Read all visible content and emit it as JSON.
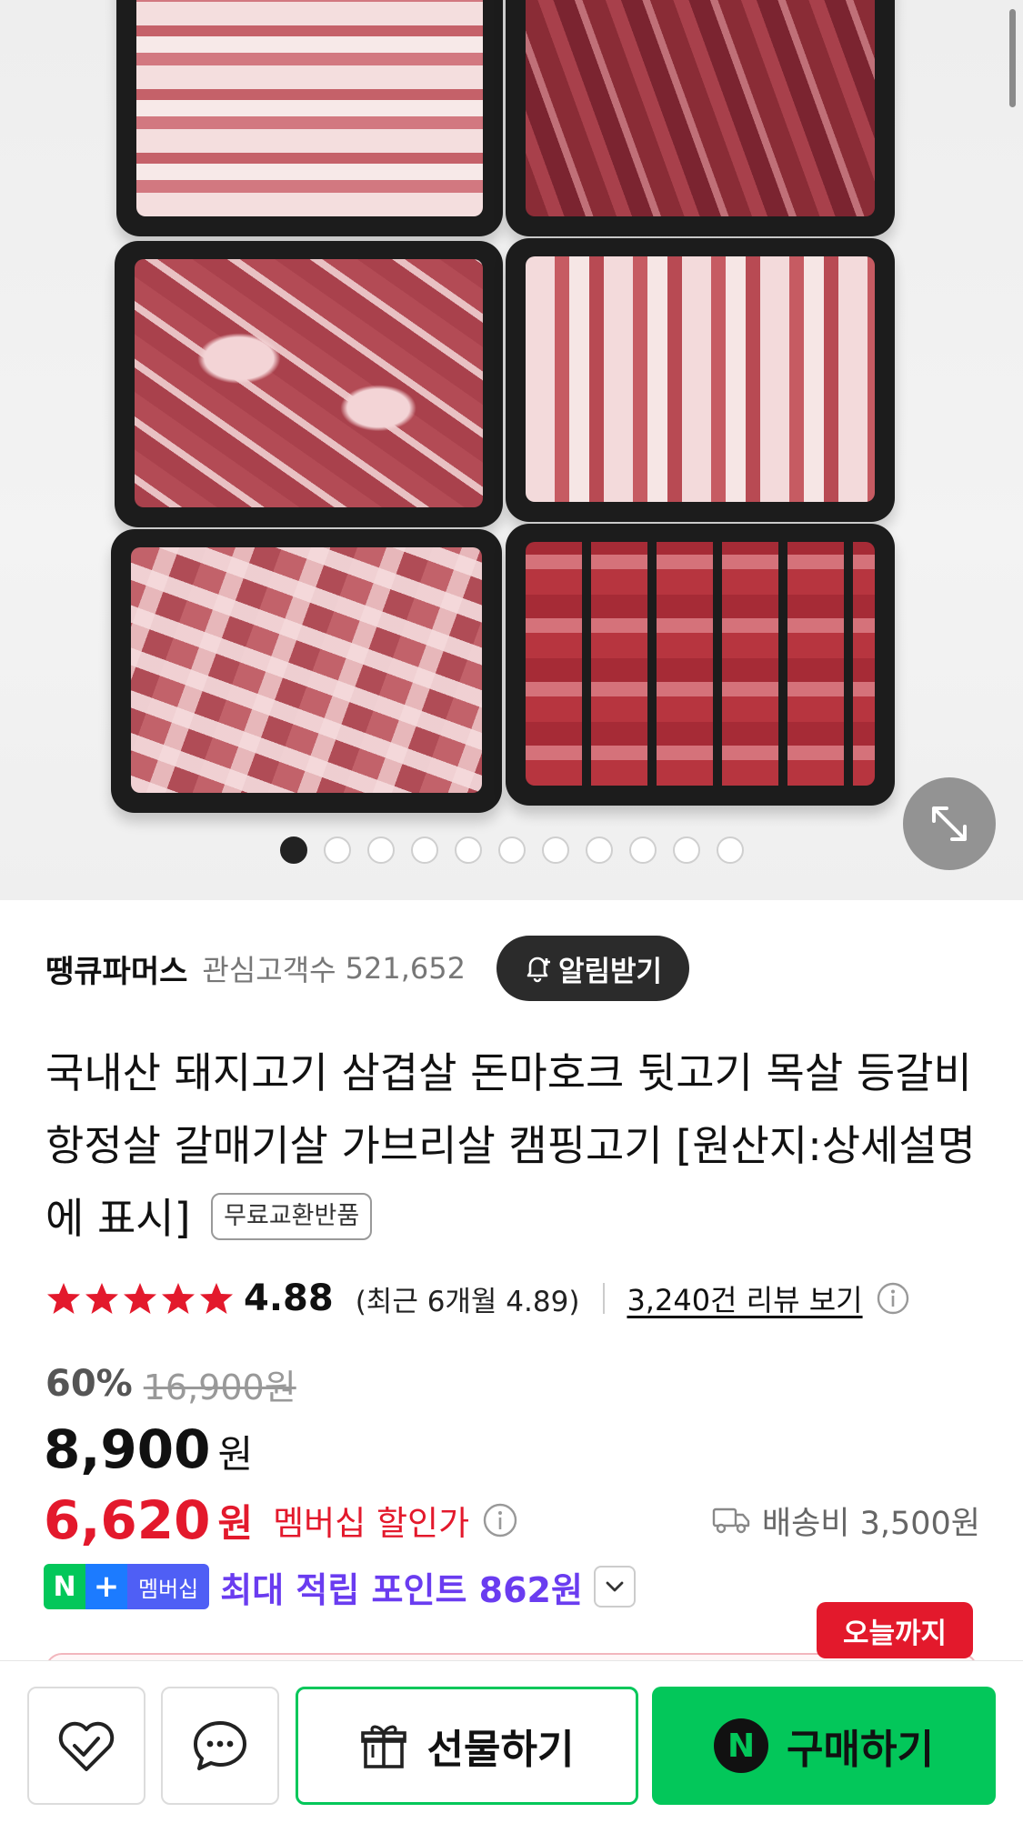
{
  "gallery": {
    "image_alt": "돼지고기 6종 트레이",
    "total_slides": 11,
    "active_index": 0
  },
  "seller": {
    "name": "땡큐파머스",
    "watchers_label": "관심고객수",
    "watchers_count": "521,652",
    "alert_button": "알림받기"
  },
  "product": {
    "title": "국내산 돼지고기 삼겹살 돈마호크 뒷고기 목살 등갈비 항정살 갈매기살 가브리살 캠핑고기 [원산지:상세설명에 표시]",
    "free_return_badge": "무료교환반품"
  },
  "rating": {
    "stars": 5,
    "value": "4.88",
    "recent": "(최근 6개월 4.89)",
    "reviews_link": "3,240건 리뷰 보기"
  },
  "price": {
    "discount_percent": "60%",
    "original": "16,900원",
    "sale_number": "8,900",
    "sale_unit": "원",
    "member_number": "6,620",
    "member_unit": "원",
    "member_label": "멤버십 할인가",
    "shipping": "배송비 3,500원"
  },
  "points": {
    "badge_n": "N",
    "badge_plus": "+",
    "badge_label": "멤버십",
    "text": "최대 적립 포인트 862원"
  },
  "promo": {
    "today_badge": "오늘까지"
  },
  "bottom_bar": {
    "gift_label": "선물하기",
    "buy_label": "구매하기",
    "npay_letter": "N"
  },
  "colors": {
    "naver_green": "#03c75a",
    "sale_red": "#e3192c",
    "points_purple": "#6a3cf0",
    "star_red": "#e3192c"
  },
  "icons": {
    "expand": "expand-diagonal-icon",
    "alert": "bell-plus-icon",
    "info": "info-circle-icon",
    "shipping": "truck-icon",
    "wishlist": "heart-check-icon",
    "chat": "chat-bubble-icon",
    "gift": "gift-box-icon"
  }
}
